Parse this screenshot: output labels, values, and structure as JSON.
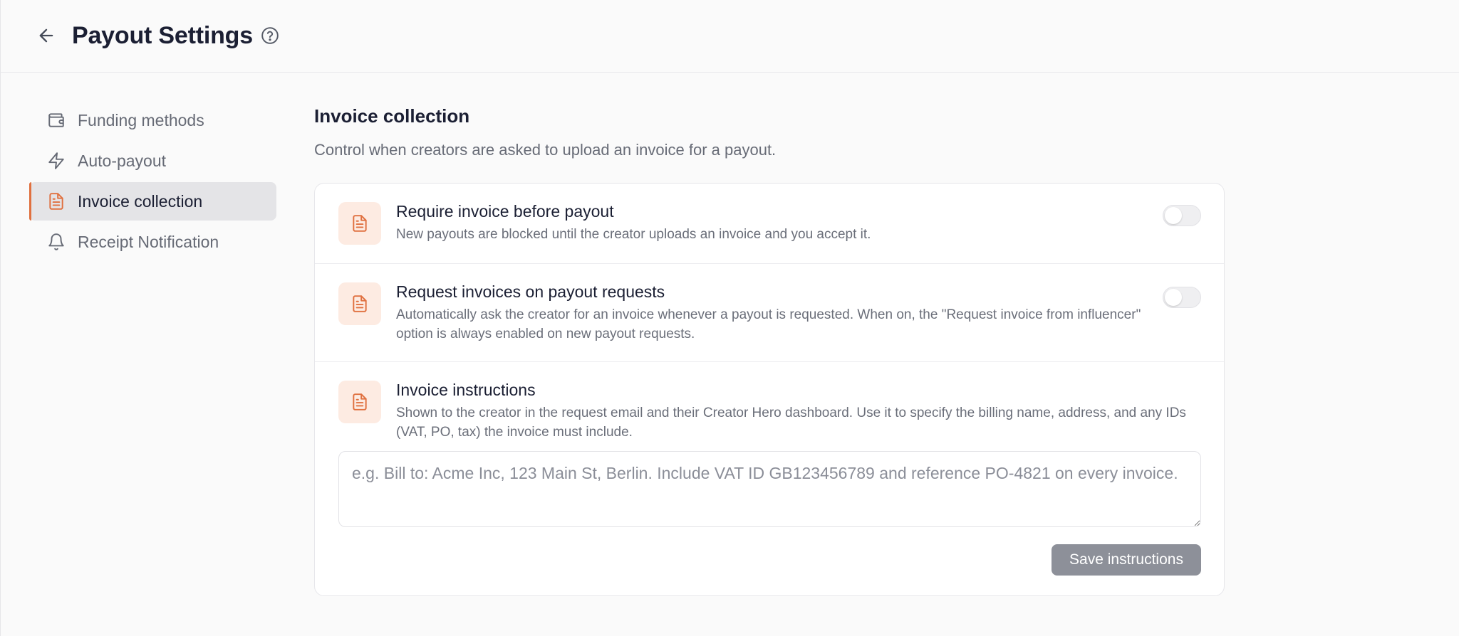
{
  "header": {
    "title": "Payout Settings",
    "back_icon": "arrow-left-icon",
    "help_icon": "question-circle-icon"
  },
  "sidebar": {
    "items": [
      {
        "label": "Funding methods",
        "icon": "wallet-icon",
        "active": false
      },
      {
        "label": "Auto-payout",
        "icon": "lightning-icon",
        "active": false
      },
      {
        "label": "Invoice collection",
        "icon": "document-icon",
        "active": true
      },
      {
        "label": "Receipt Notification",
        "icon": "bell-icon",
        "active": false
      }
    ]
  },
  "main": {
    "title": "Invoice collection",
    "description": "Control when creators are asked to upload an invoice for a payout.",
    "settings": [
      {
        "title": "Require invoice before payout",
        "description": "New payouts are blocked until the creator uploads an invoice and you accept it.",
        "enabled": false
      },
      {
        "title": "Request invoices on payout requests",
        "description": "Automatically ask the creator for an invoice whenever a payout is requested. When on, the \"Request invoice from influencer\" option is always enabled on new payout requests.",
        "enabled": false
      }
    ],
    "instructions": {
      "title": "Invoice instructions",
      "description": "Shown to the creator in the request email and their Creator Hero dashboard. Use it to specify the billing name, address, and any IDs (VAT, PO, tax) the invoice must include.",
      "value": "",
      "placeholder": "e.g. Bill to: Acme Inc, 123 Main St, Berlin. Include VAT ID GB123456789 and reference PO-4821 on every invoice.",
      "save_label": "Save instructions"
    }
  },
  "colors": {
    "accent": "#e0703f",
    "icon_bg": "#fdebe2",
    "active_nav_bg": "#e4e4e7",
    "save_button_disabled": "#8d9099"
  }
}
